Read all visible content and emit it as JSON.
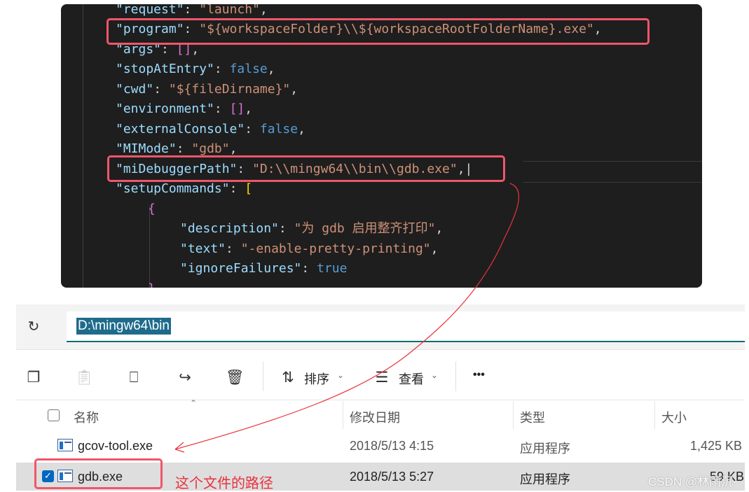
{
  "code": {
    "lines": [
      {
        "key": "\"request\"",
        "value": "\"launch\"",
        "tail": ","
      },
      {
        "key": "\"program\"",
        "value": "\"${workspaceFolder}\\\\${workspaceRootFolderName}.exe\"",
        "tail": ","
      },
      {
        "key": "\"args\"",
        "value": "[]",
        "tail": ","
      },
      {
        "key": "\"stopAtEntry\"",
        "value": "false",
        "tail": ","
      },
      {
        "key": "\"cwd\"",
        "value": "\"${fileDirname}\"",
        "tail": ","
      },
      {
        "key": "\"environment\"",
        "value": "[]",
        "tail": ","
      },
      {
        "key": "\"externalConsole\"",
        "value": "false",
        "tail": ","
      },
      {
        "key": "\"MIMode\"",
        "value": "\"gdb\"",
        "tail": ","
      },
      {
        "key": "\"miDebuggerPath\"",
        "value": "\"D:\\\\mingw64\\\\bin\\\\gdb.exe\"",
        "tail": ","
      },
      {
        "key": "\"setupCommands\"",
        "value": "[",
        "tail": ""
      },
      {
        "key": "",
        "value": "{",
        "tail": ""
      },
      {
        "key": "\"description\"",
        "value": "\"为 gdb 启用整齐打印\"",
        "tail": ","
      },
      {
        "key": "\"text\"",
        "value": "\"-enable-pretty-printing\"",
        "tail": ","
      },
      {
        "key": "\"ignoreFailures\"",
        "value": "true",
        "tail": ""
      },
      {
        "key": "",
        "value": "}",
        "tail": ""
      }
    ]
  },
  "explorer": {
    "address": "D:\\mingw64\\bin",
    "toolbar": {
      "sort_label": "排序",
      "view_label": "查看",
      "more_label": "•••"
    },
    "columns": {
      "name": "名称",
      "modified": "修改日期",
      "type": "类型",
      "size": "大小"
    },
    "files": [
      {
        "name": "gcov-tool.exe",
        "modified": "2018/5/13 4:15",
        "type": "应用程序",
        "size": "1,425 KB",
        "selected": false
      },
      {
        "name": "gdb.exe",
        "modified": "2018/5/13 5:27",
        "type": "应用程序",
        "size": "59 KB",
        "selected": true
      }
    ]
  },
  "annotation": "这个文件的路径",
  "watermark": "CSDN @林雨沉",
  "colors": {
    "highlight_box": "#f0566a",
    "annotation_text": "#e8323c",
    "editor_bg": "#1e1e1e",
    "json_key": "#9cdcfe",
    "json_string": "#ce9178",
    "json_keyword": "#569cd6",
    "address_select": "#1e6b8c"
  }
}
